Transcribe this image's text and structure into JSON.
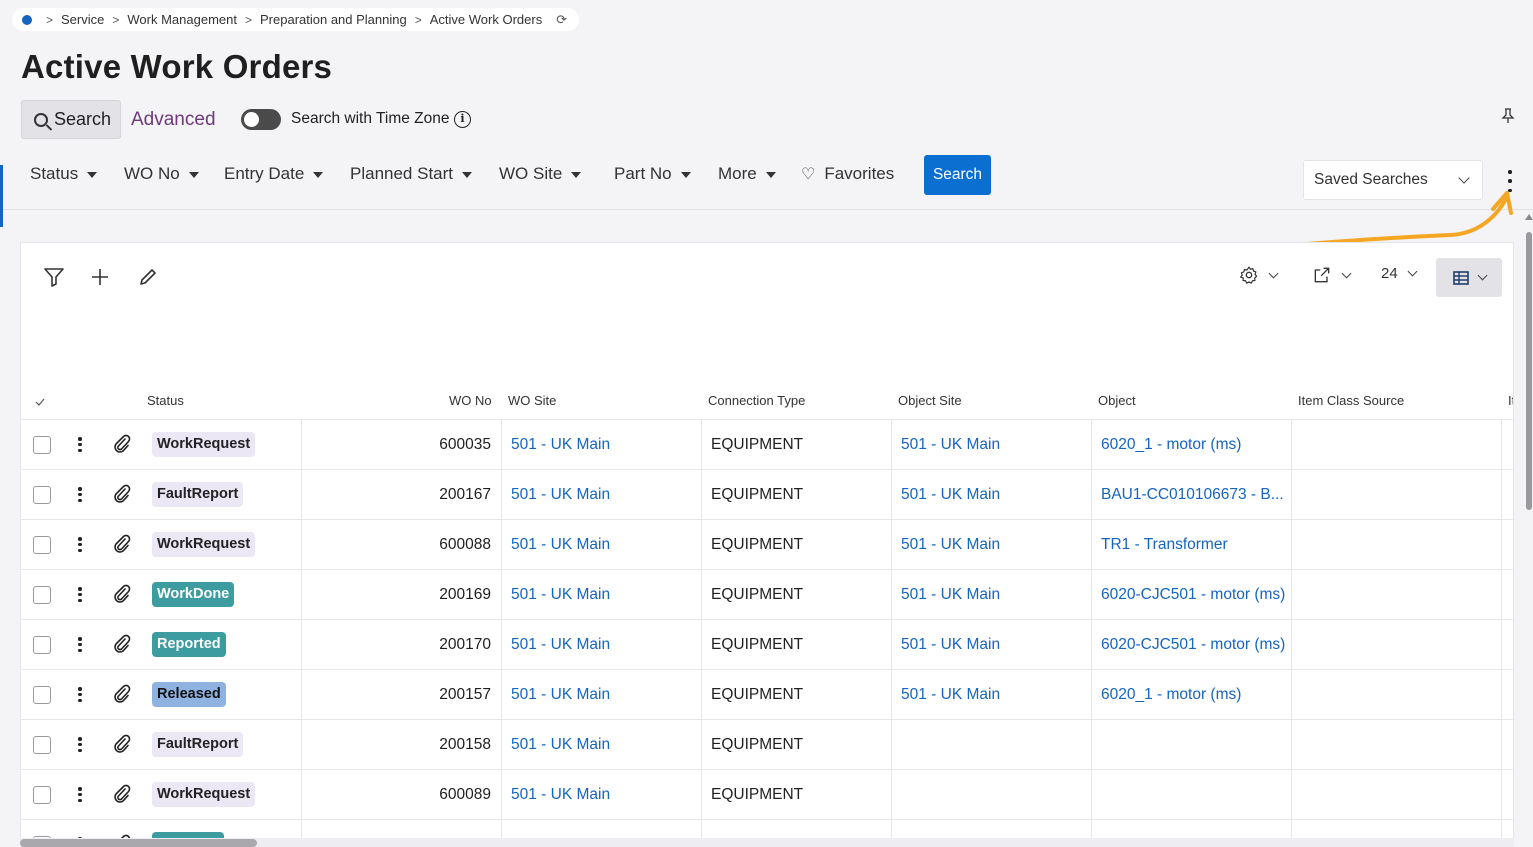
{
  "breadcrumb": {
    "items": [
      "Service",
      "Work Management",
      "Preparation and Planning",
      "Active Work Orders"
    ],
    "home_icon": "home-dot-icon",
    "refresh_icon": "refresh-icon"
  },
  "page": {
    "title": "Active Work Orders"
  },
  "search_tabs": {
    "search": "Search",
    "advanced": "Advanced"
  },
  "timezone_toggle": {
    "label": "Search with Time Zone",
    "on": false
  },
  "filters": [
    "Status",
    "WO No",
    "Entry Date",
    "Planned Start",
    "WO Site",
    "Part No",
    "More"
  ],
  "favorites_label": "Favorites",
  "search_button": "Search",
  "saved_searches": "Saved Searches",
  "toolbar": {
    "page_size": "24"
  },
  "grid": {
    "columns": [
      "Status",
      "WO No",
      "WO Site",
      "Connection Type",
      "Object Site",
      "Object",
      "Item Class Source",
      "It"
    ],
    "rows": [
      {
        "status": "WorkRequest",
        "status_style": "light",
        "wo_no": "600035",
        "wo_site": "501 - UK Main",
        "connection_type": "EQUIPMENT",
        "object_site": "501 - UK Main",
        "object": "6020_1 - motor (ms)"
      },
      {
        "status": "FaultReport",
        "status_style": "light",
        "wo_no": "200167",
        "wo_site": "501 - UK Main",
        "connection_type": "EQUIPMENT",
        "object_site": "501 - UK Main",
        "object": "BAU1-CC010106673 - B..."
      },
      {
        "status": "WorkRequest",
        "status_style": "light",
        "wo_no": "600088",
        "wo_site": "501 - UK Main",
        "connection_type": "EQUIPMENT",
        "object_site": "501 - UK Main",
        "object": "TR1 - Transformer"
      },
      {
        "status": "WorkDone",
        "status_style": "teal",
        "wo_no": "200169",
        "wo_site": "501 - UK Main",
        "connection_type": "EQUIPMENT",
        "object_site": "501 - UK Main",
        "object": "6020-CJC501 - motor (ms)"
      },
      {
        "status": "Reported",
        "status_style": "teal",
        "wo_no": "200170",
        "wo_site": "501 - UK Main",
        "connection_type": "EQUIPMENT",
        "object_site": "501 - UK Main",
        "object": "6020-CJC501 - motor (ms)"
      },
      {
        "status": "Released",
        "status_style": "blue",
        "wo_no": "200157",
        "wo_site": "501 - UK Main",
        "connection_type": "EQUIPMENT",
        "object_site": "501 - UK Main",
        "object": "6020_1 - motor (ms)"
      },
      {
        "status": "FaultReport",
        "status_style": "light",
        "wo_no": "200158",
        "wo_site": "501 - UK Main",
        "connection_type": "EQUIPMENT",
        "object_site": "",
        "object": ""
      },
      {
        "status": "WorkRequest",
        "status_style": "light",
        "wo_no": "600089",
        "wo_site": "501 - UK Main",
        "connection_type": "EQUIPMENT",
        "object_site": "",
        "object": ""
      },
      {
        "status": "",
        "status_style": "teal",
        "wo_no": "",
        "wo_site": "",
        "connection_type": "",
        "object_site": "",
        "object": ""
      }
    ]
  },
  "colors": {
    "accent": "#0b6fd1",
    "link": "#1565c0",
    "annotation": "#f5a623",
    "badge_teal": "#3c9ca0",
    "badge_blue": "#8fb3e0",
    "badge_light": "#ece7f5"
  }
}
